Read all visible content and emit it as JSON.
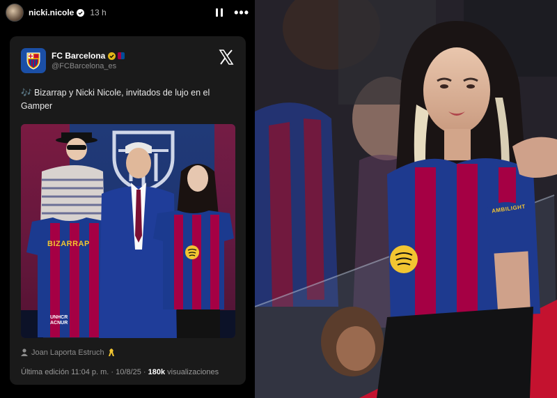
{
  "story": {
    "username": "nicki.nicole",
    "time": "13 h"
  },
  "tweet": {
    "account_name": "FC Barcelona",
    "handle": "@FCBarcelona_es",
    "text": "🎶 Bizarrap y Nicki Nicole, invitados de lujo en el Gamper",
    "photo": {
      "shirt_left_text": "BIZARRAP",
      "sponsor_text": "UNHCR ACNUR"
    },
    "photo_credit": "Joan Laporta Estruch",
    "meta_prefix": "Última edición 11:04 p. m. · 10/8/25 ·",
    "views_count": "180k",
    "views_label": "visualizaciones"
  },
  "right_photo": {
    "sleeve_text": "AMBILIGHT"
  },
  "colors": {
    "blaugrana_blue": "#1b4fa6",
    "blaugrana_red": "#a50044",
    "card_bg": "#1a1a1a"
  }
}
